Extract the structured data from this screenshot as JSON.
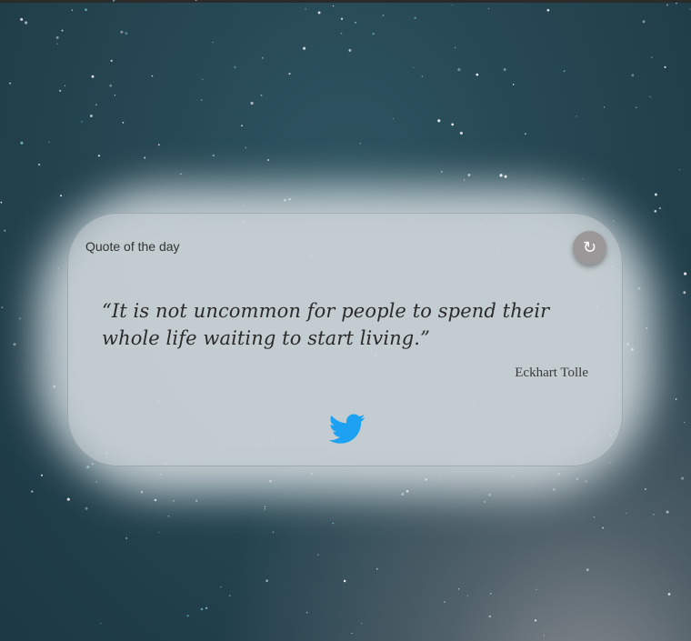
{
  "widget": {
    "title": "Quote of the day",
    "refresh_icon": "refresh-icon",
    "refresh_glyph": "↻"
  },
  "quote": {
    "text": "“It is not uncommon for people to spend their whole life waiting to start living.”",
    "author": "Eckhart Tolle"
  },
  "share": {
    "icon": "twitter-icon",
    "color": "#1da1f2"
  },
  "colors": {
    "background": "#254652",
    "card": "#c4cdd1",
    "refresh_button": "#9b9899",
    "twitter_blue": "#1da1f2"
  }
}
